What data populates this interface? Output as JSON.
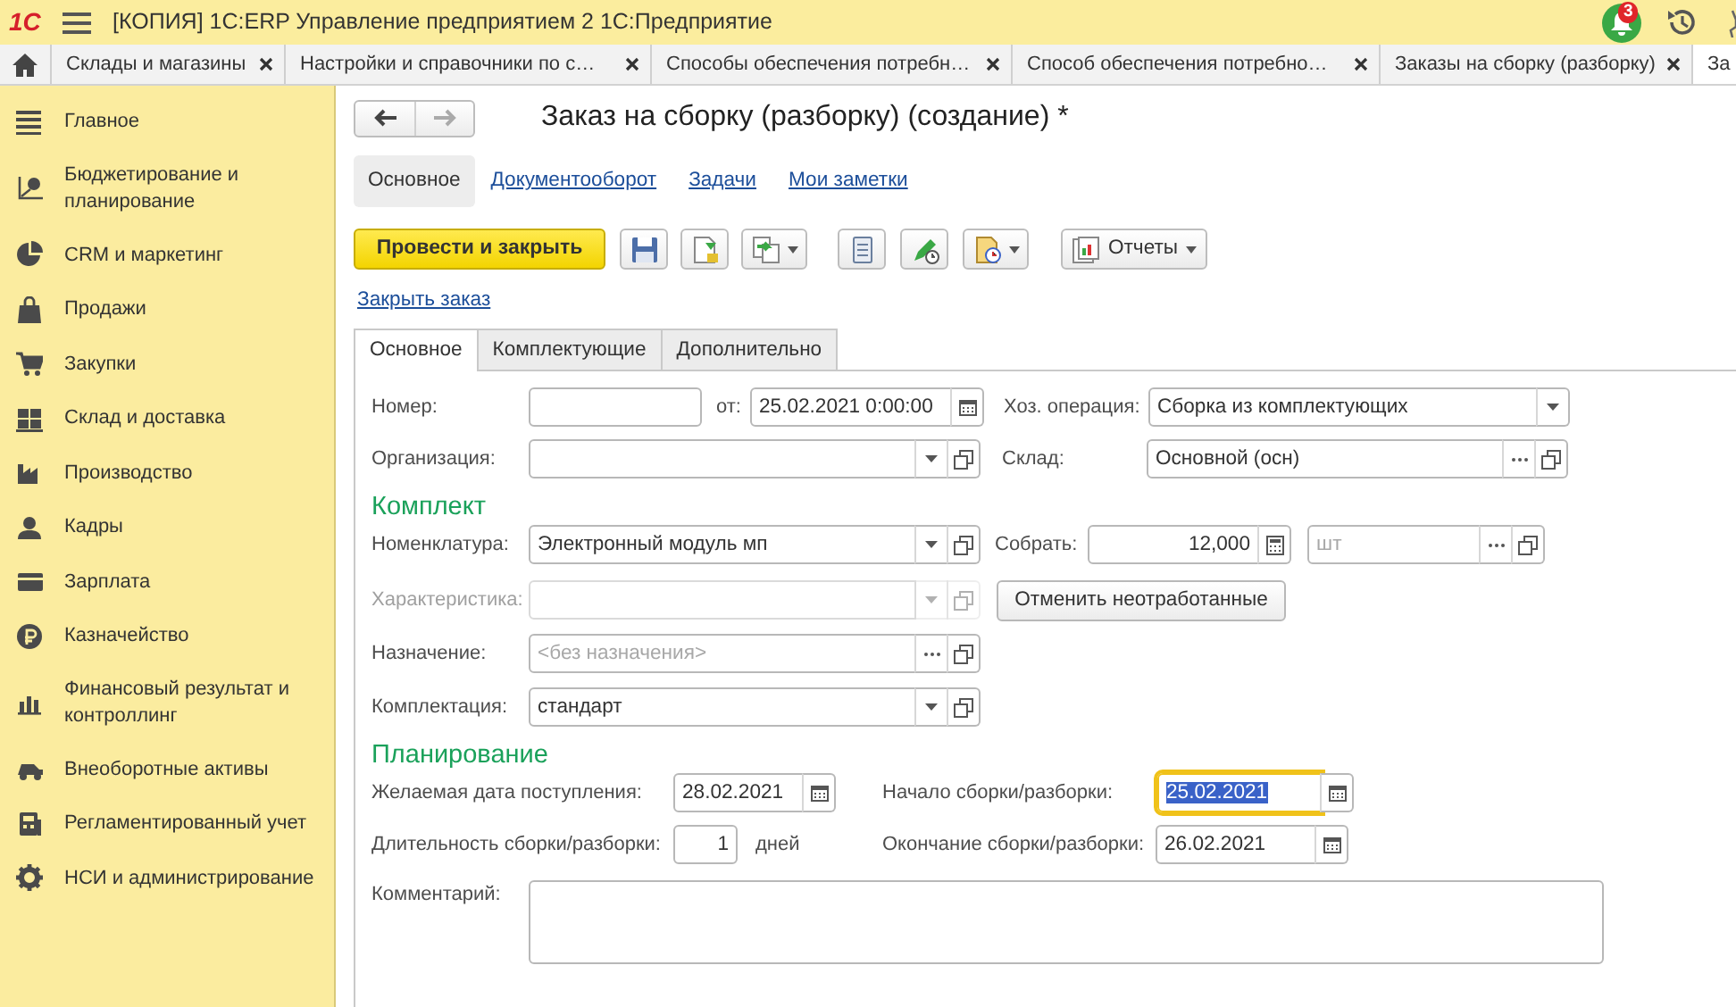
{
  "window": {
    "logo": "1С",
    "title": "[КОПИЯ] 1С:ERP Управление предприятием 2 1С:Предприятие",
    "notification_count": "3"
  },
  "open_tabs": [
    {
      "label": "Склады и магазины",
      "selected": false
    },
    {
      "label": "Настройки и справочники по с…",
      "selected": false
    },
    {
      "label": "Способы обеспечения потребн…",
      "selected": false
    },
    {
      "label": "Способ обеспечения потребно…",
      "selected": false
    },
    {
      "label": "Заказы на сборку (разборку)",
      "selected": false
    },
    {
      "label": "За",
      "selected": true
    }
  ],
  "sidebar": {
    "items": [
      {
        "label": "Главное"
      },
      {
        "label": "Бюджетирование и планирование"
      },
      {
        "label": "CRM и маркетинг"
      },
      {
        "label": "Продажи"
      },
      {
        "label": "Закупки"
      },
      {
        "label": "Склад и доставка"
      },
      {
        "label": "Производство"
      },
      {
        "label": "Кадры"
      },
      {
        "label": "Зарплата"
      },
      {
        "label": "Казначейство"
      },
      {
        "label": "Финансовый результат и контроллинг"
      },
      {
        "label": "Внеоборотные активы"
      },
      {
        "label": "Регламентированный учет"
      },
      {
        "label": "НСИ и администрирование"
      }
    ]
  },
  "form": {
    "title": "Заказ на сборку (разборку) (создание) *",
    "sections": [
      {
        "label": "Основное",
        "selected": true
      },
      {
        "label": "Документооборот",
        "selected": false
      },
      {
        "label": "Задачи",
        "selected": false
      },
      {
        "label": "Мои заметки",
        "selected": false
      }
    ],
    "toolbar": {
      "primary_button": "Провести и закрыть",
      "reports_button": "Отчеты"
    },
    "close_order_link": "Закрыть заказ",
    "tabs": [
      {
        "label": "Основное",
        "selected": true
      },
      {
        "label": "Комплектующие",
        "selected": false
      },
      {
        "label": "Дополнительно",
        "selected": false
      }
    ],
    "number": {
      "label": "Номер:"
    },
    "date": {
      "label": "от:",
      "value": "25.02.2021  0:00:00"
    },
    "operation": {
      "label": "Хоз. операция:",
      "value": "Сборка из комплектующих"
    },
    "organization": {
      "label": "Организация:"
    },
    "warehouse": {
      "label": "Склад:",
      "value": "Основной (осн)"
    },
    "kit_heading": "Комплект",
    "nomenclature": {
      "label": "Номенклатура:",
      "value": "Электронный модуль мп"
    },
    "quantity": {
      "label": "Собрать:",
      "value": "12,000"
    },
    "unit": {
      "placeholder": "шт"
    },
    "characteristic": {
      "label": "Характеристика:",
      "disabled": true
    },
    "cancel_button": "Отменить неотработанные",
    "purpose": {
      "label": "Назначение:",
      "placeholder": "<без назначения>"
    },
    "configuration": {
      "label": "Комплектация:",
      "value": "стандарт"
    },
    "planning_heading": "Планирование",
    "desired_date": {
      "label": "Желаемая дата поступления:",
      "value": "28.02.2021"
    },
    "start_date": {
      "label": "Начало сборки/разборки:",
      "value": "25.02.2021",
      "focused": true
    },
    "duration": {
      "label": "Длительность сборки/разборки:",
      "value": "1",
      "unit": "дней"
    },
    "end_date": {
      "label": "Окончание сборки/разборки:",
      "value": "26.02.2021"
    },
    "comment": {
      "label": "Комментарий:"
    }
  }
}
